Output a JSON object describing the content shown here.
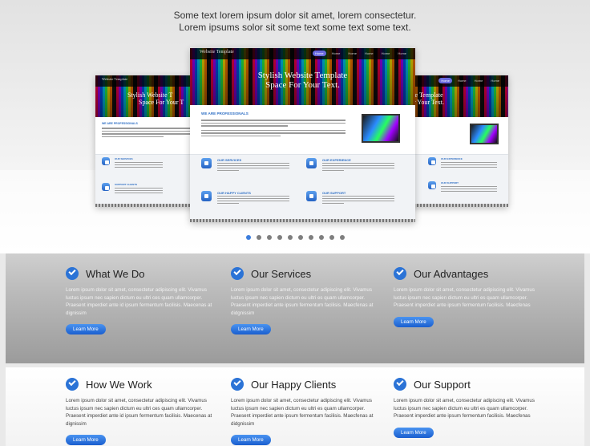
{
  "hero": {
    "tagline_line1": "Some text lorem ipsum dolor sit amet, lorem consectetur.",
    "tagline_line2": "Lorem ipsums solor sit some text some text some text."
  },
  "mockups": {
    "brand": "Website Template",
    "headline_line1": "Stylish Website Template",
    "headline_line2": "Space For Your Text.",
    "side_headline_line1": "Stylish Website T",
    "side_headline_line2": "Space For Your T",
    "right_headline_line1": "site Template",
    "right_headline_line2": "r Your Text.",
    "nav_items": [
      "Home",
      "Home",
      "Home",
      "Home",
      "Home",
      "Home"
    ],
    "section_title": "WE ARE PROFESSIONALS",
    "features": [
      "OUR SERVICES",
      "OUR EXPERIENCE",
      "OUR HAPPY CLIENTS",
      "OUR SUPPORT"
    ],
    "left_features": [
      "OUR SERVICES",
      "SUPPORT CLIENTS"
    ],
    "right_features": [
      "OUR EXPERIENCE",
      "OUR SUPPORT"
    ]
  },
  "slider": {
    "total": 10,
    "active_index": 0,
    "accent": "#3c7ddc"
  },
  "features_top": [
    {
      "title": "What We Do",
      "body": "Lorem ipsum dolor sit amet, consectetur adipiscing elit. Vivamus luctus ipsum nec sapien dictum eu ultri ces quam ullamcorper. Praesent imperdiet ante id ipsum fermentum facilisis. Maecenas at dignissim",
      "button": "Learn More"
    },
    {
      "title": "Our Services",
      "body": "Lorem ipsum dolor sit amet, consectetur adipiscing elit. Vivamus luctus ipsum nec sapien dictum eu ultri es quam ullamcorper. Praesent imperdiet ante ipsum fermentum facilisis. Maecfenas at didgnissim",
      "button": "Learn More"
    },
    {
      "title": "Our Advantages",
      "body": "Lorem ipsum dolor sit amet, consectetur adipiscing elit. Vivamus luctus ipsum nec sapien dictum eu ultri es quam ullamcorper. Praesent imperdiet ante ipsum fermentum facilisis. Maecfenas",
      "button": "Learn More"
    }
  ],
  "features_bottom": [
    {
      "title": "How We Work",
      "body": "Lorem ipsum dolor sit amet, consectetur adipiscing elit. Vivamus luctus ipsum nec sapien dictum eu ultri ces quam ullamcorper. Praesent imperdiet ante id ipsum fermentum facilisis. Maecenas at dignissim",
      "button": "Learn More"
    },
    {
      "title": "Our Happy Clients",
      "body": "Lorem ipsum dolor sit amet, consectetur adipiscing elit. Vivamus luctus ipsum nec sapien dictum eu ultri es quam ullamcorper. Praesent imperdiet ante ipsum fermentum facilisis. Maecfenas at didgnissim",
      "button": "Learn More"
    },
    {
      "title": "Our Support",
      "body": "Lorem ipsum dolor sit amet, consectetur adipiscing elit. Vivamus luctus ipsum nec sapien dictum eu ultri es quam ullamcorper. Praesent imperdiet ante ipsum fermentum facilisis. Maecfenas",
      "button": "Learn More"
    }
  ],
  "colors": {
    "accent": "#2b73d6",
    "button": "#1a5fcf",
    "band_dark": "#9b9b9b"
  }
}
